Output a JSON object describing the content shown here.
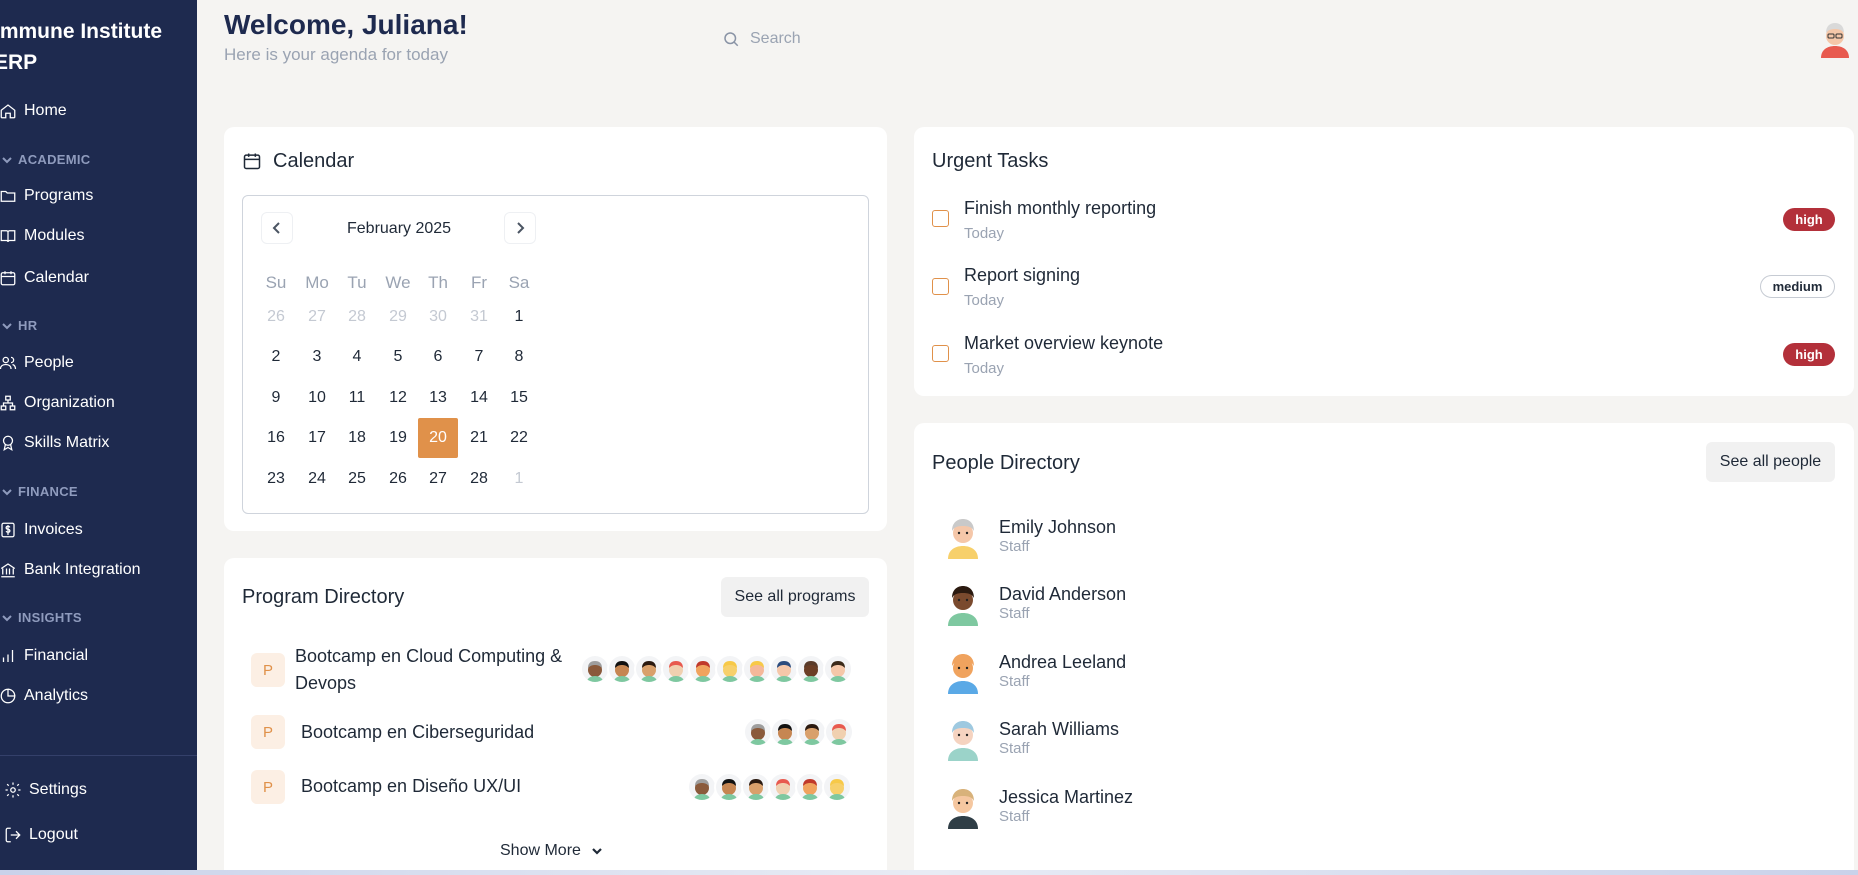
{
  "sidebar": {
    "brand": "Immune Institute ERP",
    "home": "Home",
    "sections": {
      "academic": "ACADEMIC",
      "hr": "HR",
      "finance": "FINANCE",
      "insights": "INSIGHTS"
    },
    "items": {
      "programs": "Programs",
      "modules": "Modules",
      "calendar": "Calendar",
      "people": "People",
      "organization": "Organization",
      "skills_matrix": "Skills Matrix",
      "invoices": "Invoices",
      "bank_integration": "Bank Integration",
      "financial": "Financial",
      "analytics": "Analytics"
    },
    "settings": "Settings",
    "logout": "Logout"
  },
  "header": {
    "welcome": "Welcome, Juliana!",
    "subtitle": "Here is your agenda for today",
    "search_placeholder": "Search"
  },
  "calendar": {
    "title": "Calendar",
    "month": "February 2025",
    "weekdays": [
      "Su",
      "Mo",
      "Tu",
      "We",
      "Th",
      "Fr",
      "Sa"
    ],
    "weeks": [
      [
        "26",
        "27",
        "28",
        "29",
        "30",
        "31",
        "1"
      ],
      [
        "2",
        "3",
        "4",
        "5",
        "6",
        "7",
        "8"
      ],
      [
        "9",
        "10",
        "11",
        "12",
        "13",
        "14",
        "15"
      ],
      [
        "16",
        "17",
        "18",
        "19",
        "20",
        "21",
        "22"
      ],
      [
        "23",
        "24",
        "25",
        "26",
        "27",
        "28",
        "1"
      ]
    ],
    "selected_day": "20"
  },
  "tasks": {
    "title": "Urgent Tasks",
    "items": [
      {
        "title": "Finish monthly reporting",
        "due": "Today",
        "priority": "high"
      },
      {
        "title": "Report signing",
        "due": "Today",
        "priority": "medium"
      },
      {
        "title": "Market overview keynote",
        "due": "Today",
        "priority": "high"
      }
    ]
  },
  "programs": {
    "title": "Program Directory",
    "see_all": "See all programs",
    "icon_letter": "P",
    "items": [
      {
        "name": "Bootcamp en Cloud Computing & Devops",
        "name_line1": "Bootcamp en Cloud Computing &",
        "name_line2": "Devops"
      },
      {
        "name": "Bootcamp en Ciberseguridad"
      },
      {
        "name": "Bootcamp en Diseño UX/UI"
      }
    ],
    "show_more": "Show More"
  },
  "people": {
    "title": "People Directory",
    "see_all": "See all people",
    "items": [
      {
        "name": "Emily Johnson",
        "role": "Staff"
      },
      {
        "name": "David Anderson",
        "role": "Staff"
      },
      {
        "name": "Andrea Leeland",
        "role": "Staff"
      },
      {
        "name": "Sarah Williams",
        "role": "Staff"
      },
      {
        "name": "Jessica Martinez",
        "role": "Staff"
      }
    ]
  },
  "colors": {
    "sidebar_bg": "#1e2a4f",
    "accent": "#e0914a",
    "high_badge": "#b3303a",
    "background": "#f5f4f2"
  }
}
